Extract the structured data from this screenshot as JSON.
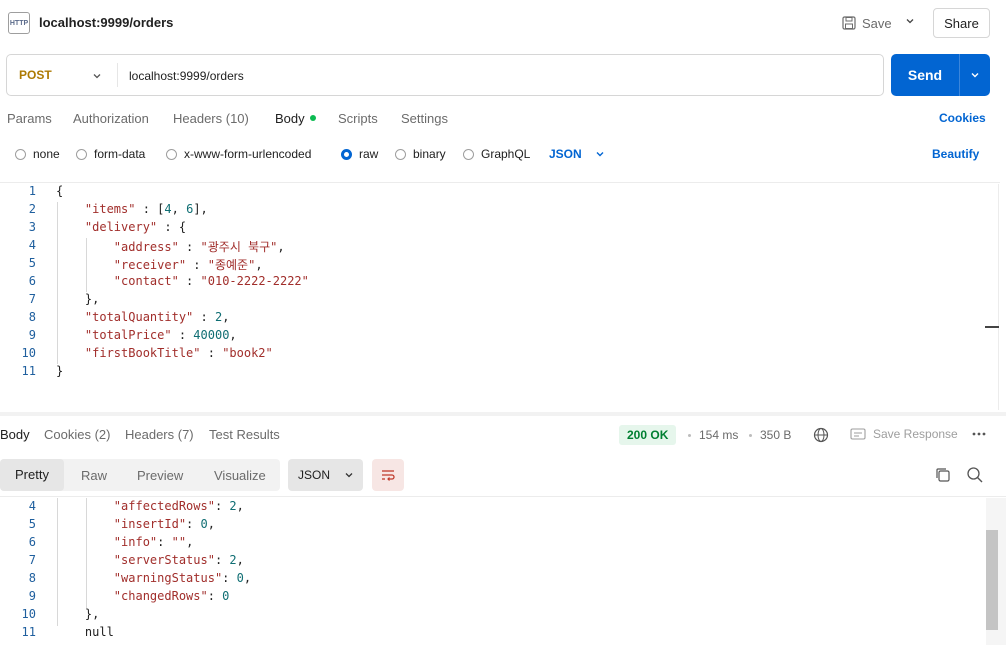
{
  "header": {
    "icon": "http-icon",
    "icon_text": "HTTP",
    "title": "localhost:9999/orders",
    "save_label": "Save",
    "share_label": "Share"
  },
  "request": {
    "method": "POST",
    "url": "localhost:9999/orders",
    "send_label": "Send",
    "tabs": [
      {
        "label": "Params",
        "active": false
      },
      {
        "label": "Authorization",
        "active": false
      },
      {
        "label": "Headers (10)",
        "active": false
      },
      {
        "label": "Body",
        "active": true
      },
      {
        "label": "Scripts",
        "active": false
      },
      {
        "label": "Settings",
        "active": false
      }
    ],
    "cookies_label": "Cookies",
    "body_types": [
      {
        "label": "none",
        "selected": false
      },
      {
        "label": "form-data",
        "selected": false
      },
      {
        "label": "x-www-form-urlencoded",
        "selected": false
      },
      {
        "label": "raw",
        "selected": true
      },
      {
        "label": "binary",
        "selected": false
      },
      {
        "label": "GraphQL",
        "selected": false
      }
    ],
    "format": "JSON",
    "beautify_label": "Beautify",
    "body_lines": [
      {
        "n": "1",
        "text": "{"
      },
      {
        "n": "2",
        "text": "    \"items\" : [4, 6],"
      },
      {
        "n": "3",
        "text": "    \"delivery\" : {"
      },
      {
        "n": "4",
        "text": "        \"address\" : \"광주시 북구\","
      },
      {
        "n": "5",
        "text": "        \"receiver\" : \"종예준\","
      },
      {
        "n": "6",
        "text": "        \"contact\" : \"010-2222-2222\""
      },
      {
        "n": "7",
        "text": "    },"
      },
      {
        "n": "8",
        "text": "    \"totalQuantity\" : 2,"
      },
      {
        "n": "9",
        "text": "    \"totalPrice\" : 40000,"
      },
      {
        "n": "10",
        "text": "    \"firstBookTitle\" : \"book2\""
      },
      {
        "n": "11",
        "text": "}"
      }
    ]
  },
  "response": {
    "tabs": [
      {
        "label": "Body",
        "active": true
      },
      {
        "label": "Cookies (2)",
        "active": false
      },
      {
        "label": "Headers (7)",
        "active": false
      },
      {
        "label": "Test Results",
        "active": false
      }
    ],
    "status": "200 OK",
    "time": "154 ms",
    "size": "350 B",
    "save_response_label": "Save Response",
    "views": [
      "Pretty",
      "Raw",
      "Preview",
      "Visualize"
    ],
    "format": "JSON",
    "body_lines": [
      {
        "n": "4",
        "text": "        \"affectedRows\": 2,"
      },
      {
        "n": "5",
        "text": "        \"insertId\": 0,"
      },
      {
        "n": "6",
        "text": "        \"info\": \"\","
      },
      {
        "n": "7",
        "text": "        \"serverStatus\": 2,"
      },
      {
        "n": "8",
        "text": "        \"warningStatus\": 0,"
      },
      {
        "n": "9",
        "text": "        \"changedRows\": 0"
      },
      {
        "n": "10",
        "text": "    },"
      },
      {
        "n": "11",
        "text": "    null"
      }
    ]
  },
  "colors": {
    "accent": "#0265d2",
    "method": "#ad7a03",
    "status_ok": "#007f31",
    "json_key": "#a12e2b",
    "json_number": "#0f6e73"
  }
}
